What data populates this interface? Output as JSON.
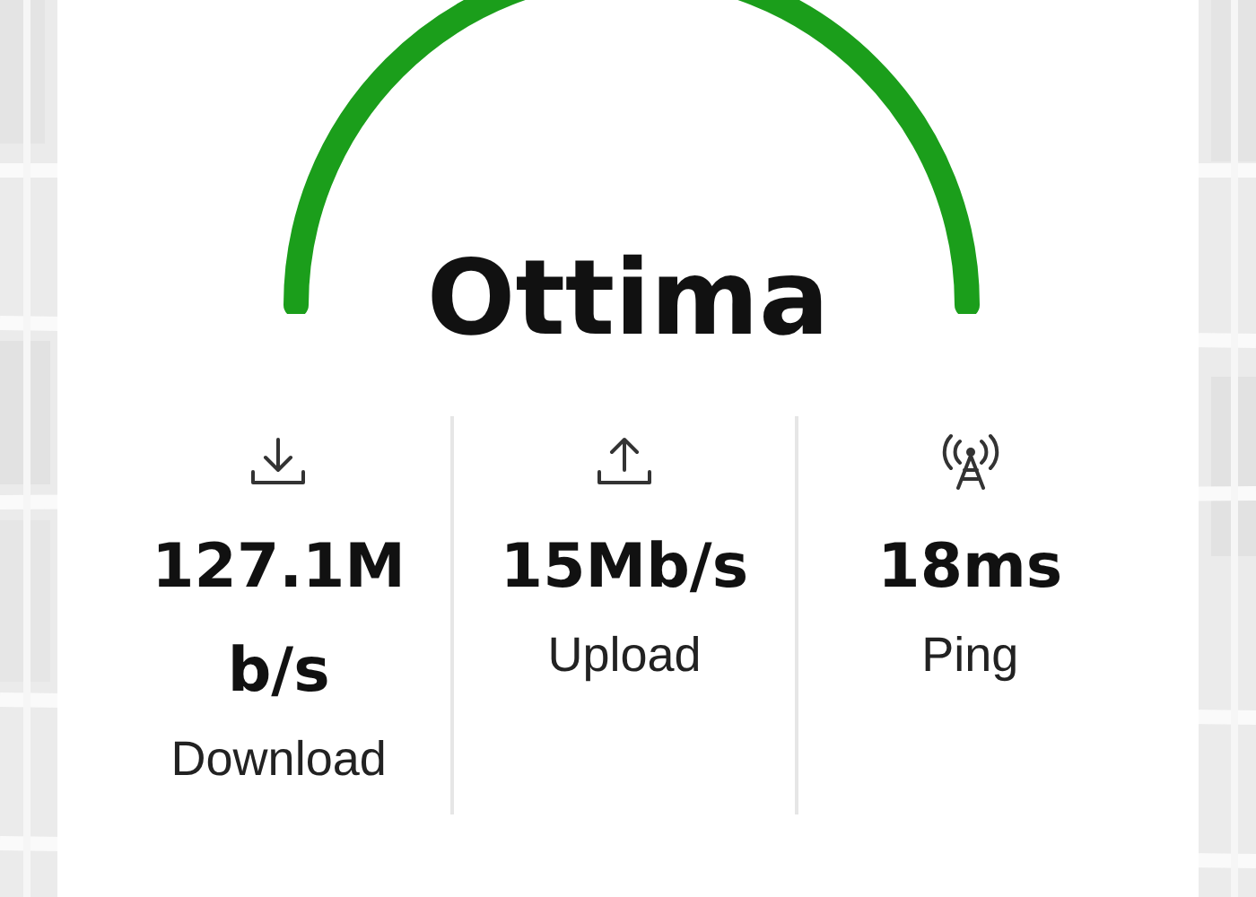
{
  "gauge": {
    "rating": "Ottima"
  },
  "stats": [
    {
      "kind": "download",
      "value": "127.1Mb/s",
      "label": "Download"
    },
    {
      "kind": "upload",
      "value": "15Mb/s",
      "label": "Upload"
    },
    {
      "kind": "ping",
      "value": "18ms",
      "label": "Ping"
    }
  ]
}
